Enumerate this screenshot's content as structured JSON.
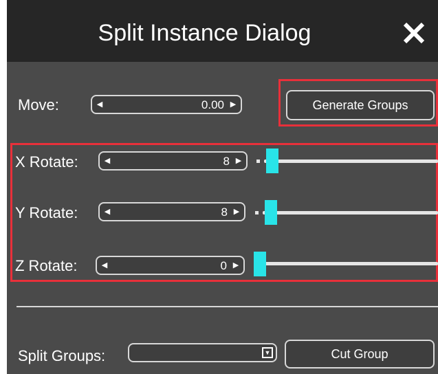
{
  "dialog": {
    "title": "Split Instance Dialog",
    "close_icon": "close-icon"
  },
  "move": {
    "label": "Move:",
    "value": "0.00"
  },
  "generate_groups": {
    "label": "Generate Groups"
  },
  "rotations": [
    {
      "label": "X Rotate:",
      "value": "8",
      "slider_fraction": 0.03
    },
    {
      "label": "Y Rotate:",
      "value": "8",
      "slider_fraction": 0.03
    },
    {
      "label": "Z Rotate:",
      "value": "0",
      "slider_fraction": 0.0
    }
  ],
  "split_groups": {
    "label": "Split Groups:",
    "selected": ""
  },
  "cut_group": {
    "label": "Cut Group"
  },
  "colors": {
    "panel_bg": "#4a4a4a",
    "titlebar_bg": "#262626",
    "highlight": "#e8303a",
    "slider_thumb": "#29e4e8"
  }
}
